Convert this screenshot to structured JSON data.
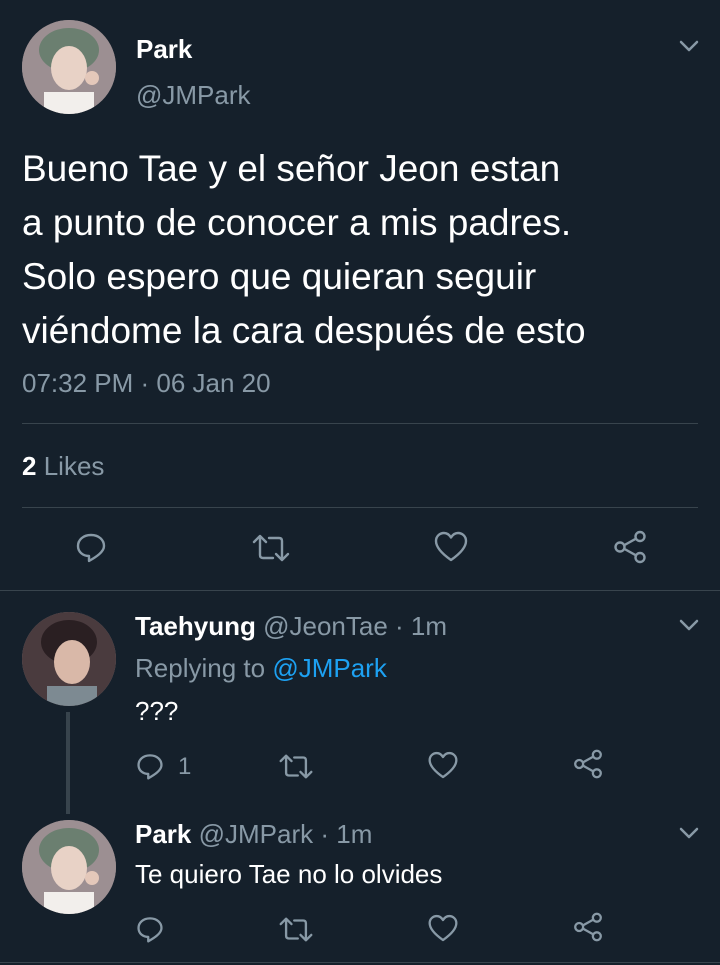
{
  "colors": {
    "background": "#15202b",
    "text": "#ffffff",
    "muted": "#8899a6",
    "link": "#1da1f2",
    "divider": "#38444d"
  },
  "main_tweet": {
    "author_name": "Park",
    "author_handle": "@JMPark",
    "text_lines": [
      "Bueno Tae y el señor Jeon estan",
      "a punto de conocer a mis padres.",
      "Solo espero que quieran seguir",
      "viéndome la cara después de esto"
    ],
    "timestamp": "07:32 PM · 06 Jan 20",
    "likes_count": "2",
    "likes_label": "Likes",
    "icons": [
      "reply-icon",
      "retweet-icon",
      "like-icon",
      "share-icon"
    ]
  },
  "replies": [
    {
      "author_name": "Taehyung",
      "author_handle": "@JeonTae",
      "time": "· 1m",
      "replying_label": "Replying to",
      "replying_handle": "@JMPark",
      "text": "???",
      "reply_count": "1"
    },
    {
      "author_name": "Park",
      "author_handle": "@JMPark",
      "time": "· 1m",
      "text": "Te quiero Tae no lo olvides",
      "reply_count": ""
    }
  ]
}
